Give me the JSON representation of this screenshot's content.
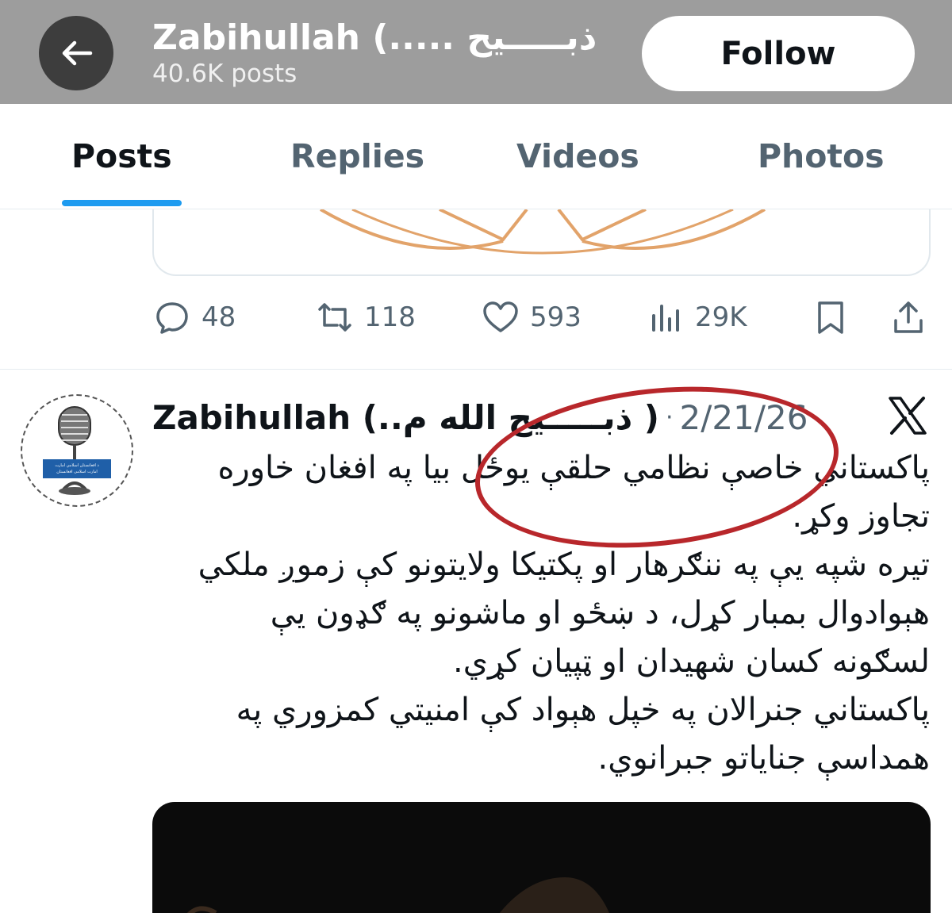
{
  "header": {
    "name": "Zabihullah (..... ذبـــــیح",
    "post_count": "40.6K posts",
    "follow_label": "Follow",
    "background": "#9d9d9d"
  },
  "tabs": [
    {
      "label": "Posts",
      "active": true
    },
    {
      "label": "Replies",
      "active": false
    },
    {
      "label": "Videos",
      "active": false
    },
    {
      "label": "Photos",
      "active": false
    }
  ],
  "accent_color": "#1d9bf0",
  "previous_post": {
    "replies": "48",
    "reposts": "118",
    "likes": "593",
    "views": "29K"
  },
  "post": {
    "author": "Zabihullah (..ذبـــــیح الله م )",
    "separator": "·",
    "date": "2/21/26",
    "avatar_caption_line1": "د افغانستان اسلامي امارت",
    "avatar_caption_line2": "امارت اسلامی افغانستان",
    "text_lines": [
      "پاکستاني خاصې نظامي حلقې یوځل بیا په افغان خاوره",
      "تجاوز وکړ.",
      "تیره شپه یې په ننګرهار او پکتیکا ولایتونو کې زموږ ملکي",
      "هېوادوال بمبار کړل، د ښځو او ماشونو په ګډون يې",
      "لسګونه کسان شهیدان او ټپیان کړي.",
      "پاکستاني جنرالان په خپل هېواد کې امنیتي کمزوري په",
      "همداسې جنایاتو جبرانوي."
    ],
    "annotation_color": "#b8272b"
  }
}
